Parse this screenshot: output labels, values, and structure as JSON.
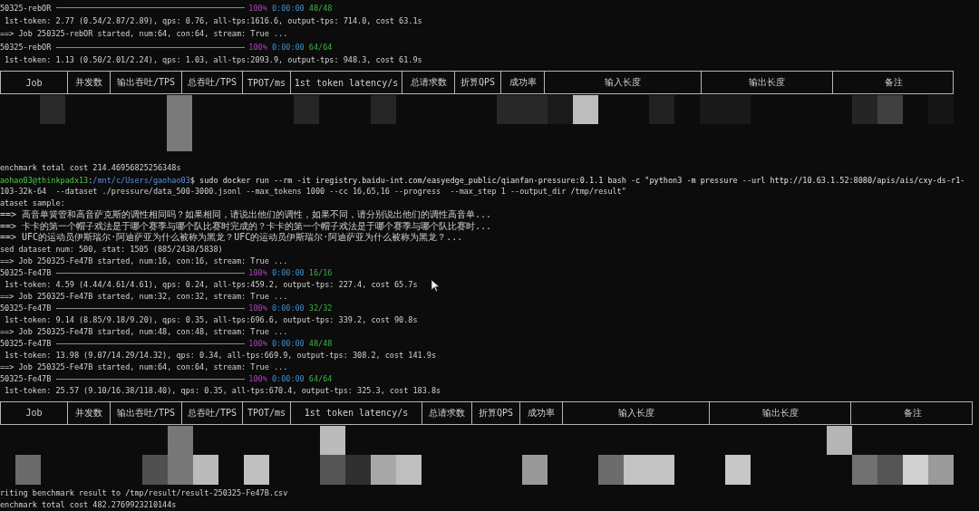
{
  "terminal": {
    "sections": [
      {
        "kind": "progress",
        "job": "50325-rebOR",
        "level": 1,
        "percent": "100%",
        "elapsed": "0:00:00",
        "count": "48/48"
      },
      {
        "kind": "text",
        "text": " 1st-token: 2.77 (0.54/2.87/2.89), qps: 0.76, all-tps:1616.6, output-tps: 714.0, cost 63.1s"
      },
      {
        "kind": "text",
        "text": "==> Job 250325-rebOR started, num:64, con:64, stream: True ..."
      },
      {
        "kind": "progress",
        "job": "50325-rebOR",
        "level": 1,
        "percent": "100%",
        "elapsed": "0:00:00",
        "count": "64/64"
      },
      {
        "kind": "text",
        "text": " 1st-token: 1.13 (0.50/2.01/2.24), qps: 1.03, all-tps:2093.9, output-tps: 948.3, cost 61.9s"
      },
      {
        "kind": "table",
        "columns": [
          "Job",
          "并发数",
          "输出吞吐/TPS",
          "总吞吐/TPS",
          "TPOT/ms",
          "1st token latency/s",
          "总请求数",
          "折算QPS",
          "成功率",
          "输入长度",
          "输出长度",
          "备注"
        ]
      },
      {
        "kind": "text",
        "text": "enchmark total cost 214.46956825256348s"
      },
      {
        "kind": "prompt",
        "user_host": "aohao03@thinkpadx13",
        "separator": ":",
        "path": "/mnt/c/Users/gaohao03",
        "command": "$ sudo docker run --rm -it iregistry.baidu-int.com/easyedge_public/qianfan-pressure:0.1.1 bash -c \"python3 -m pressure --url http://10.63.1.52:8080/apis/ais/cxy-ds-r1-"
      },
      {
        "kind": "text",
        "text": "103-32k-64  --dataset ./pressure/data_500-3000.jsonl --max_tokens 1000 --cc 16,65,16 --progress  --max_step 1 --output_dir /tmp/result\""
      },
      {
        "kind": "text",
        "text": "ataset sample:"
      },
      {
        "kind": "sample",
        "text": "==> 高音单簧管和高音萨克斯的调性相同吗？如果相同，请说出他们的调性，如果不同，请分别说出他们的调性高音单..."
      },
      {
        "kind": "sample",
        "text": "==> 卡卡的第一个帽子戏法是于哪个赛季与哪个队比赛时完成的？卡卡的第一个帽子戏法是于哪个赛季与哪个队比赛时..."
      },
      {
        "kind": "sample",
        "text": "==> UFC的运动员伊斯瑞尔·阿迪萨亚为什么被称为黑龙？UFC的运动员伊斯瑞尔·阿迪萨亚为什么被称为黑龙？..."
      },
      {
        "kind": "text",
        "text": "sed dataset num: 500, stat: 1505 (885/2438/5838)"
      },
      {
        "kind": "text",
        "text": "==> Job 250325-Fe47B started, num:16, con:16, stream: True ..."
      },
      {
        "kind": "progress",
        "job": "50325-Fe47B",
        "level": 1,
        "percent": "100%",
        "elapsed": "0:00:00",
        "count": "16/16"
      },
      {
        "kind": "text",
        "text": " 1st-token: 4.59 (4.44/4.61/4.61), qps: 0.24, all-tps:459.2, output-tps: 227.4, cost 65.7s"
      },
      {
        "kind": "text",
        "text": "==> Job 250325-Fe47B started, num:32, con:32, stream: True ..."
      },
      {
        "kind": "progress",
        "job": "50325-Fe47B",
        "level": 1,
        "percent": "100%",
        "elapsed": "0:00:00",
        "count": "32/32"
      },
      {
        "kind": "text",
        "text": " 1st-token: 9.14 (8.85/9.18/9.20), qps: 0.35, all-tps:696.6, output-tps: 339.2, cost 90.8s"
      },
      {
        "kind": "text",
        "text": "==> Job 250325-Fe47B started, num:48, con:48, stream: True ..."
      },
      {
        "kind": "progress",
        "job": "50325-Fe47B",
        "level": 1,
        "percent": "100%",
        "elapsed": "0:00:00",
        "count": "48/48"
      },
      {
        "kind": "text",
        "text": " 1st-token: 13.98 (9.07/14.29/14.32), qps: 0.34, all-tps:669.9, output-tps: 308.2, cost 141.9s"
      },
      {
        "kind": "text",
        "text": "==> Job 250325-Fe47B started, num:64, con:64, stream: True ..."
      },
      {
        "kind": "progress",
        "job": "50325-Fe47B",
        "level": 1,
        "percent": "100%",
        "elapsed": "0:00:00",
        "count": "64/64"
      },
      {
        "kind": "text",
        "text": " 1st-token: 25.57 (9.10/16.38/118.40), qps: 0.35, all-tps:670.4, output-tps: 325.3, cost 183.8s"
      },
      {
        "kind": "table",
        "columns": [
          "Job",
          "并发数",
          "输出吞吐/TPS",
          "总吞吐/TPS",
          "TPOT/ms",
          "1st token latency/s",
          "总请求数",
          "折算QPS",
          "成功率",
          "输入长度",
          "输出长度",
          "备注"
        ]
      },
      {
        "kind": "text",
        "text": "riting benchmark result to /tmp/result/result-250325-Fe47B.csv"
      },
      {
        "kind": "text",
        "text": "enchmark total cost 482.2769923210144s"
      }
    ]
  }
}
